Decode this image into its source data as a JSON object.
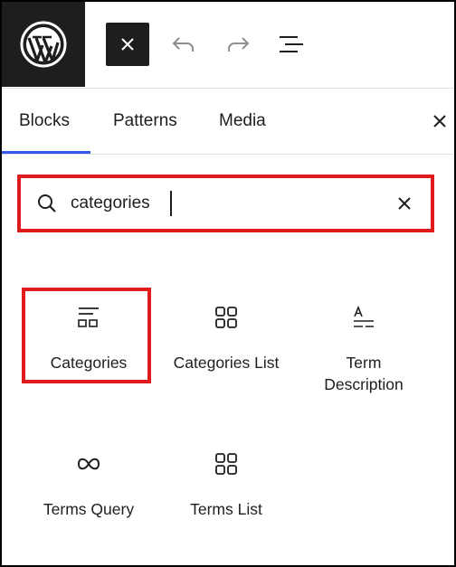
{
  "toolbar": {
    "logo_icon": "wordpress-logo-icon",
    "close_icon": "close-icon",
    "undo_icon": "undo-icon",
    "redo_icon": "redo-icon",
    "outline_icon": "document-overview-icon"
  },
  "tabs": [
    {
      "label": "Blocks",
      "active": true
    },
    {
      "label": "Patterns",
      "active": false
    },
    {
      "label": "Media",
      "active": false
    }
  ],
  "search": {
    "value": "categories",
    "placeholder": "Search",
    "icon": "search-icon",
    "clear_icon": "close-icon"
  },
  "blocks": [
    {
      "label": "Categories",
      "icon": "categories-icon",
      "highlighted": true
    },
    {
      "label": "Categories List",
      "icon": "grid-icon"
    },
    {
      "label": "Term Description",
      "icon": "term-description-icon"
    },
    {
      "label": "Terms Query",
      "icon": "terms-query-icon"
    },
    {
      "label": "Terms List",
      "icon": "grid-icon"
    }
  ],
  "colors": {
    "highlight": "#e11b1b",
    "accent": "#3858e9",
    "dark": "#1e1e1e"
  }
}
